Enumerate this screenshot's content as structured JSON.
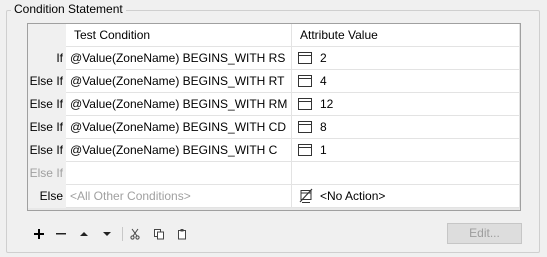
{
  "group": {
    "title": "Condition Statement"
  },
  "table": {
    "headers": {
      "test_condition": "Test Condition",
      "attribute_value": "Attribute Value"
    },
    "rows": [
      {
        "label": "If",
        "condition": "@Value(ZoneName) BEGINS_WITH RS",
        "value": "2"
      },
      {
        "label": "Else If",
        "condition": "@Value(ZoneName) BEGINS_WITH RT",
        "value": "4"
      },
      {
        "label": "Else If",
        "condition": "@Value(ZoneName) BEGINS_WITH RM",
        "value": "12"
      },
      {
        "label": "Else If",
        "condition": "@Value(ZoneName) BEGINS_WITH CD",
        "value": "8"
      },
      {
        "label": "Else If",
        "condition": "@Value(ZoneName) BEGINS_WITH C",
        "value": "1"
      }
    ],
    "empty_row": {
      "label": "Else If"
    },
    "else_row": {
      "label": "Else",
      "condition": "<All Other Conditions>",
      "value": "<No Action>"
    }
  },
  "toolbar": {
    "icons": [
      "add-icon",
      "remove-icon",
      "move-up-icon",
      "move-down-icon",
      "cut-icon",
      "copy-icon",
      "paste-icon"
    ]
  },
  "edit_button": {
    "label": "Edit..."
  }
}
